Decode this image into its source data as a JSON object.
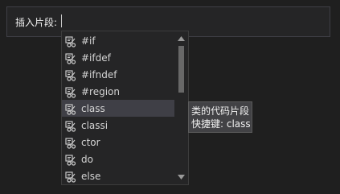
{
  "prompt": {
    "label": "插入片段:",
    "value": ""
  },
  "snippets": {
    "items": [
      {
        "label": "#if"
      },
      {
        "label": "#ifdef"
      },
      {
        "label": "#ifndef"
      },
      {
        "label": "#region"
      },
      {
        "label": "class",
        "selected": true
      },
      {
        "label": "classi"
      },
      {
        "label": "ctor"
      },
      {
        "label": "do"
      },
      {
        "label": "else"
      }
    ],
    "icon": "snippet-icon"
  },
  "tooltip": {
    "title": "类的代码片段",
    "shortcut": "快捷键: class"
  },
  "colors": {
    "background": "#1f1f1f",
    "list_background": "#252526",
    "selected_row": "#3f3f46",
    "text": "#d4d4d4"
  }
}
